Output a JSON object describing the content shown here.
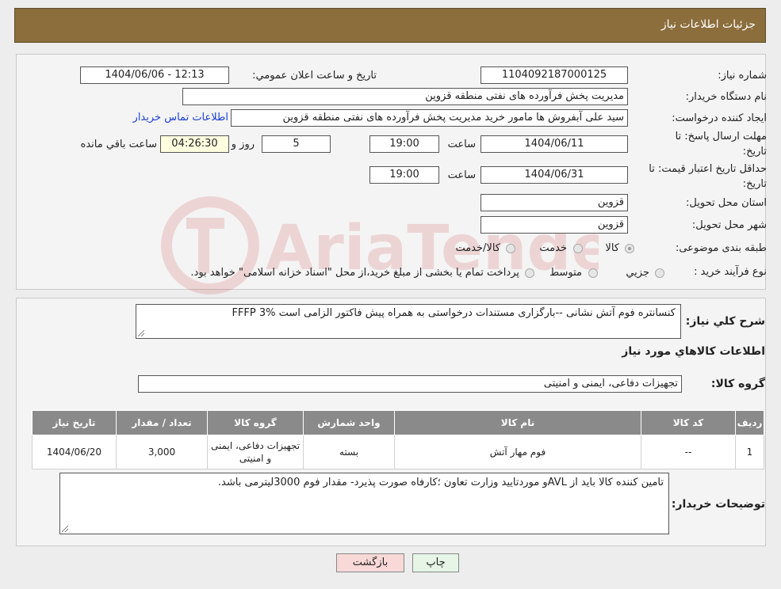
{
  "header": {
    "title": "جزئیات اطلاعات نیاز"
  },
  "watermark": {
    "text": "AriaTender.neT",
    "color": "#c33"
  },
  "fields": {
    "need_number": {
      "label": "شماره نیاز:",
      "value": "1104092187000125"
    },
    "announce_datetime": {
      "label": "تاریخ و ساعت اعلان عمومي:",
      "value": "1404/06/06 - 12:13"
    },
    "buyer_org": {
      "label": "نام دستگاه خریدار:",
      "value": "مدیریت پخش فرآورده های نفتی منطقه قزوین"
    },
    "requester": {
      "label": "ایجاد کننده درخواست:",
      "value": "سید علی  آبفروش ها مامور خرید مدیریت پخش فرآورده های نفتی منطقه قزوین",
      "contact_link": "اطلاعات تماس خریدار"
    },
    "reply_deadline": {
      "label_line1": "مهلت ارسال پاسخ: تا",
      "label_line2": "تاریخ:",
      "date": "1404/06/11",
      "time_label": "ساعت",
      "time": "19:00",
      "days": "5",
      "days_label": "روز و",
      "remaining": "04:26:30",
      "remaining_label": "ساعت باقي مانده"
    },
    "price_validity": {
      "label_line1": "حداقل تاریخ اعتبار قیمت: تا",
      "label_line2": "تاریخ:",
      "date": "1404/06/31",
      "time_label": "ساعت",
      "time": "19:00"
    },
    "province": {
      "label": "استان محل تحویل:",
      "value": "قزوین"
    },
    "city": {
      "label": "شهر محل تحویل:",
      "value": "قزوین"
    },
    "category": {
      "label": "طبقه بندی موضوعی:",
      "options": [
        "کالا",
        "خدمت",
        "کالا/خدمت"
      ],
      "selected": "کالا"
    },
    "process_type": {
      "label": "نوع فرآیند خرید :",
      "options": [
        "جزيي",
        "متوسط"
      ],
      "note": "پرداخت تمام یا بخشی از مبلغ خرید،از محل \"اسناد خزانه اسلامی\" خواهد بود."
    }
  },
  "description": {
    "label": "شرح کلي نياز:",
    "value": "کنسانتره فوم آتش نشانی --بارگزاری مستندات درخواستی به همراه پیش فاکتور الزامی است FFFP 3%"
  },
  "goods_section": {
    "title": "اطلاعات کالاهاي مورد نياز",
    "group_label": "گروه کالا:",
    "group_value": "تجهیزات دفاعی، ایمنی و امنیتی"
  },
  "table": {
    "headers": [
      "ردیف",
      "کد کالا",
      "نام کالا",
      "واحد شمارش",
      "گروه کالا",
      "تعداد / مقدار",
      "تاریخ نیاز"
    ],
    "rows": [
      {
        "row": "1",
        "code": "--",
        "name": "فوم مهار آتش",
        "unit": "بسته",
        "group": "تجهیزات دفاعی، ایمنی و امنیتی",
        "qty": "3,000",
        "date": "1404/06/20"
      }
    ]
  },
  "buyer_notes": {
    "label": "توضیحات خریدار:",
    "value": "تامین کننده کالا باید از  AVLو موردتایید وزارت تعاون ؛کارفاه صورت پذیرد- مقدار فوم 3000لیترمی باشد."
  },
  "buttons": {
    "print": "چاپ",
    "back": "بازگشت"
  },
  "colors": {
    "header_bg": "#8b6e3c",
    "table_header_bg": "#8a8a8a",
    "link": "#1a3fd6",
    "back_button_bg": "#f9d8d8",
    "print_button_bg": "#e6f5e6"
  }
}
